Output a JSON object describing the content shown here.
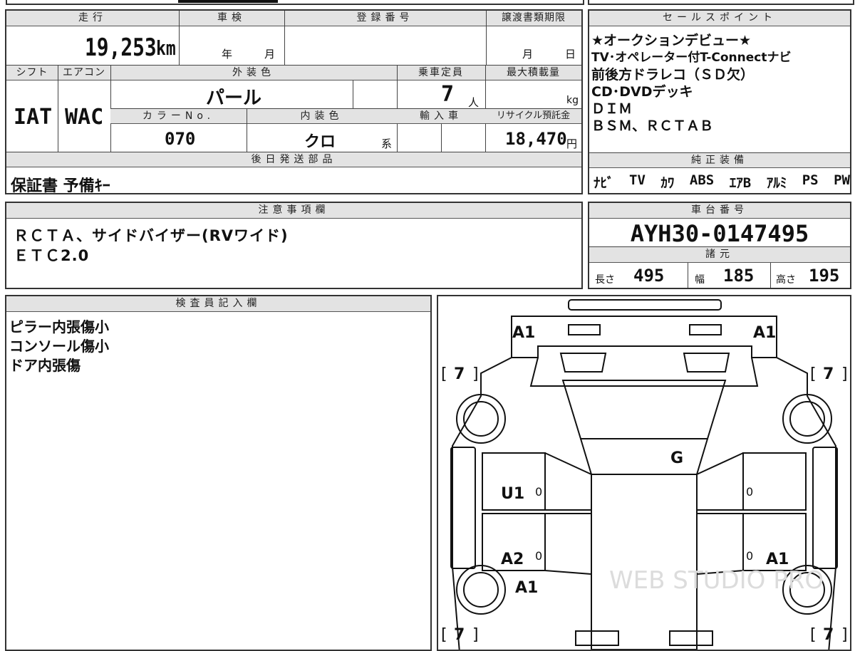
{
  "header": {
    "mileage_label": "走行",
    "inspection_label": "車検",
    "registration_label": "登録番号",
    "transfer_label": "譲渡書類期限",
    "sales_label": "セールスポイント"
  },
  "mileage": {
    "value": "19,253",
    "unit": "km"
  },
  "inspection": {
    "year_unit": "年",
    "month_unit": "月"
  },
  "transfer": {
    "month_unit": "月",
    "day_unit": "日"
  },
  "specs": {
    "shift_label": "シフト",
    "aircon_label": "エアコン",
    "exterior_label": "外装色",
    "capacity_label": "乗車定員",
    "load_label": "最大積載量",
    "shift_value": "IAT",
    "aircon_value": "WAC",
    "exterior_value": "パール",
    "capacity_value": "7",
    "capacity_unit": "人",
    "load_unit": "kg",
    "color_no_label": "カラーNo.",
    "interior_label": "内装色",
    "import_label": "輸入車",
    "recycle_label": "リサイクル預託金",
    "color_no_value": "070",
    "interior_value": "クロ",
    "interior_unit": "系",
    "recycle_value": "18,470",
    "recycle_unit": "円"
  },
  "sales_points": [
    "★オークションデビュー★",
    "TV･オペレーター付T-Connectナビ",
    "前後方ドラレコ（ＳＤ欠）",
    "CD･DVDデッキ",
    "ＤＩＭ",
    "ＢＳＭ、ＲＣＴＡＢ"
  ],
  "later_parts": {
    "label": "後日発送部品",
    "value": "保証書 予備ｷｰ"
  },
  "equipment": {
    "label": "純正装備",
    "items": [
      "ﾅﾋﾞ",
      "TV",
      "ｶﾜ",
      "ABS",
      "ｴｱB",
      "ｱﾙﾐ",
      "PS",
      "PW"
    ]
  },
  "notes": {
    "label": "注意事項欄",
    "lines": [
      "ＲＣＴＡ、サイドバイザー(RVワイド)",
      "ＥＴＣ2.0"
    ]
  },
  "chassis": {
    "label": "車台番号",
    "value": "AYH30-0147495"
  },
  "dimensions": {
    "label": "諸元",
    "length_label": "長さ",
    "length_value": "495",
    "width_label": "幅",
    "width_value": "185",
    "height_label": "高さ",
    "height_value": "195"
  },
  "inspector": {
    "label": "検査員記入欄",
    "lines": [
      "ピラー内張傷小",
      "コンソール傷小",
      "ドア内張傷"
    ]
  },
  "diagram": {
    "marks": {
      "front_left": "A1",
      "front_right": "A1",
      "windshield": "G",
      "front_door_left": "U1",
      "rear_door_left": "A2",
      "rear_door_right": "A1",
      "rear_fender_left": "A1",
      "tire_fl": "7",
      "tire_fr": "7",
      "tire_rl": "7",
      "tire_rr": "7",
      "door_fl_code": "0",
      "door_fr_code": "0",
      "door_rl_code": "0",
      "door_rr_code": "0"
    },
    "watermark": "WEB STUDIO PRO"
  }
}
